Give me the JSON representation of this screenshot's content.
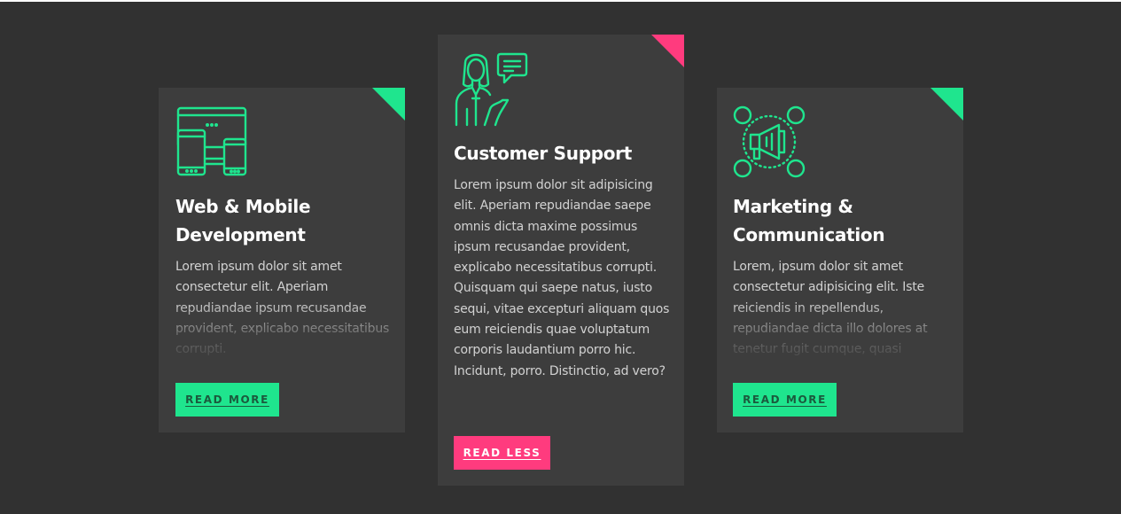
{
  "colors": {
    "background": "#313131",
    "card": "#3d3d3d",
    "accent_green": "#1fe58e",
    "accent_pink": "#ff3b7e",
    "text_muted": "#d2d2d2"
  },
  "cards": [
    {
      "icon": "devices-icon",
      "title_line1": "Web & Mobile",
      "title_line2": "Development",
      "description": "Lorem ipsum dolor sit amet consectetur elit. Aperiam repudiandae ipsum recusandae provident, explicabo necessitatibus corrupti.",
      "button_label": "READ MORE",
      "corner_color": "#1fe58e",
      "expanded": false
    },
    {
      "icon": "customer-support-icon",
      "title_line1": "Customer Support",
      "description": "Lorem ipsum dolor sit adipisicing elit. Aperiam repudiandae saepe omnis dicta maxime possimus ipsum recusandae provident, explicabo necessitatibus corrupti. Quisquam qui saepe natus, iusto sequi, vitae excepturi aliquam quos eum reiciendis quae voluptatum corporis laudantium porro hic. Incidunt, porro. Distinctio, ad vero?",
      "button_label": "READ LESS",
      "corner_color": "#ff3b7e",
      "expanded": true
    },
    {
      "icon": "megaphone-icon",
      "title_line1": "Marketing &",
      "title_line2": "Communication",
      "description": "Lorem, ipsum dolor sit amet consectetur adipisicing elit. Iste reiciendis in repellendus, repudiandae dicta illo dolores at tenetur fugit cumque, quasi",
      "button_label": "READ MORE",
      "corner_color": "#1fe58e",
      "expanded": false
    }
  ]
}
